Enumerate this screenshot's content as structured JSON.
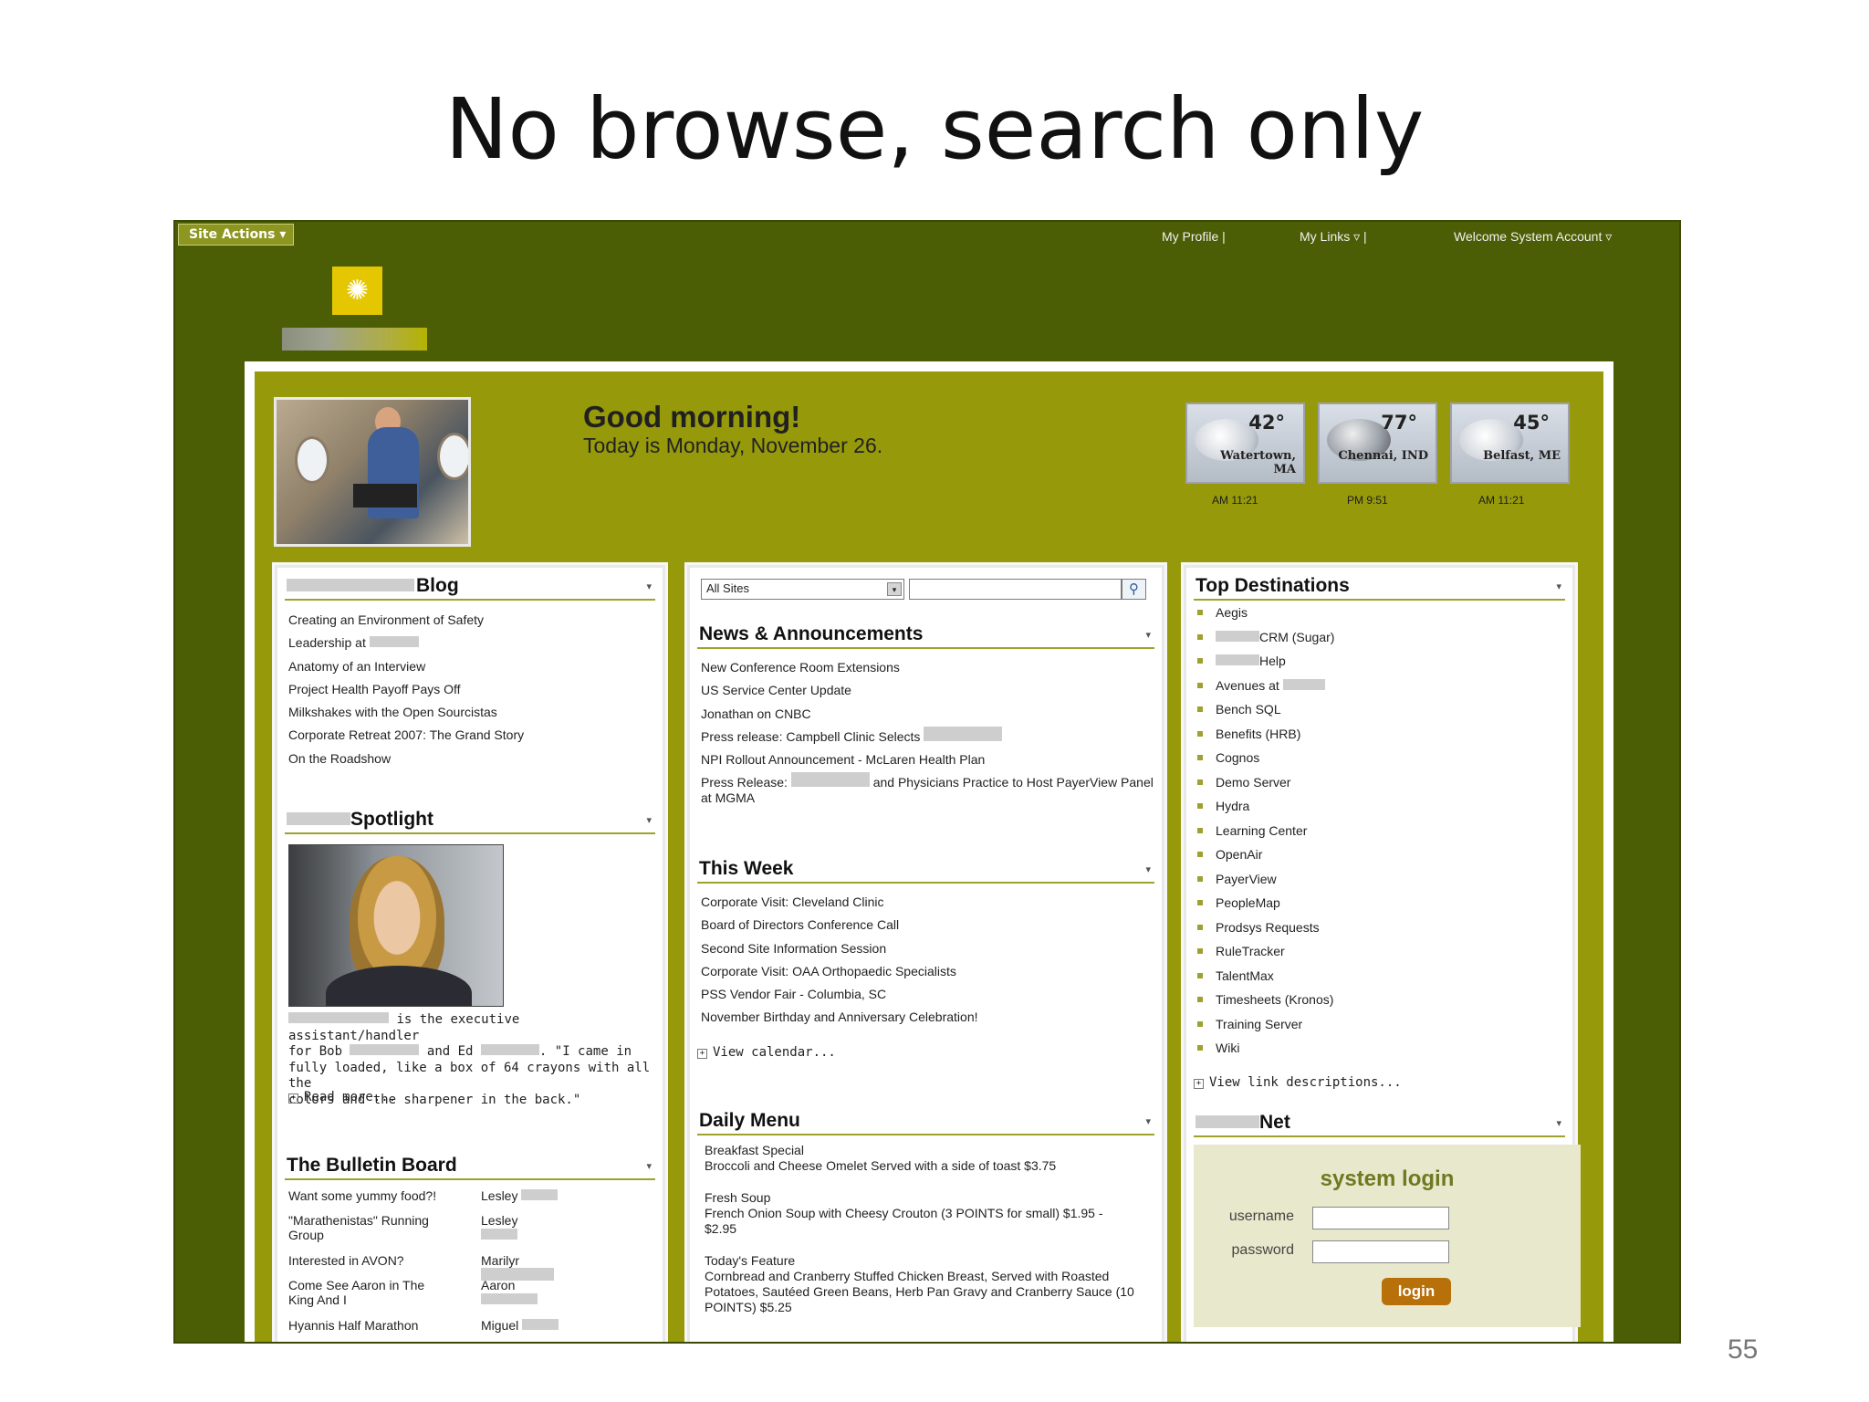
{
  "slide": {
    "title": "No browse, search only",
    "number": "55"
  },
  "topbar": {
    "site_actions": "Site Actions ▾",
    "my_profile": "My Profile |",
    "my_links": "My Links ▿ |",
    "welcome": "Welcome System Account ▿"
  },
  "colors": {
    "header_bg": "#4c5e05",
    "canvas_bg": "#96990a",
    "accent": "#b8700a"
  },
  "greeting": {
    "title": "Good morning!",
    "date": "Today is Monday, November 26."
  },
  "weather": [
    {
      "temp": "42°",
      "city": "Watertown, MA",
      "time": "AM  11:21"
    },
    {
      "temp": "77°",
      "city": "Chennai, IND",
      "time": "PM  9:51"
    },
    {
      "temp": "45°",
      "city": "Belfast, ME",
      "time": "AM  11:21"
    }
  ],
  "blog": {
    "title": "Blog",
    "items": [
      "Creating an Environment of Safety",
      "Leadership at",
      "Anatomy of an Interview",
      "Project Health Payoff Pays Off",
      "Milkshakes with the Open Sourcistas",
      "Corporate Retreat 2007: The Grand Story",
      "On the Roadshow"
    ]
  },
  "spotlight": {
    "title": "Spotlight",
    "caption_1": "is the executive assistant/handler",
    "caption_2": "for Bob",
    "caption_2b": "and Ed",
    "caption_2c": ". \"I came in",
    "caption_3": "fully loaded, like a box of 64 crayons with all the",
    "caption_4": "colors and the sharpener in the back.\"",
    "read_more": "Read more..."
  },
  "bulletin": {
    "title": "The Bulletin Board",
    "rows": [
      {
        "text": "Want some yummy food?!",
        "who": "Lesley"
      },
      {
        "text": "\"Marathenistas\" Running Group",
        "who": "Lesley"
      },
      {
        "text": "Interested in AVON?",
        "who": "Marilyr"
      },
      {
        "text": "Come See Aaron in The King And I",
        "who": "Aaron"
      },
      {
        "text": "Hyannis Half Marathon",
        "who": "Miguel"
      }
    ]
  },
  "search": {
    "scope": "All Sites",
    "placeholder": ""
  },
  "news": {
    "title": "News & Announcements",
    "items": [
      "New Conference Room Extensions",
      "US Service Center Update",
      "Jonathan on CNBC",
      "Press release: Campbell Clinic Selects",
      "NPI Rollout Announcement - McLaren Health Plan"
    ],
    "last_a": "Press Release:",
    "last_b": "and Physicians Practice to Host PayerView Panel",
    "last_c": "at MGMA"
  },
  "this_week": {
    "title": "This Week",
    "items": [
      "Corporate Visit: Cleveland Clinic",
      "Board of Directors Conference Call",
      "Second Site Information Session",
      "Corporate Visit: OAA Orthopaedic Specialists",
      "PSS Vendor Fair - Columbia, SC",
      "November Birthday and Anniversary Celebration!"
    ],
    "view_calendar": "View calendar..."
  },
  "daily_menu": {
    "title": "Daily Menu",
    "breakfast_label": "Breakfast Special",
    "breakfast": "Broccoli and Cheese Omelet Served with a side of toast $3.75",
    "soup_label": "Fresh Soup",
    "soup_1": "French Onion Soup with Cheesy Crouton (3 POINTS for small)  $1.95 -",
    "soup_2": "$2.95",
    "feature_label": "Today's Feature",
    "feature_1": "Cornbread and Cranberry Stuffed Chicken Breast, Served with Roasted",
    "feature_2": "Potatoes, Sautéed Green Beans, Herb Pan Gravy and Cranberry Sauce (10",
    "feature_3": "POINTS)  $5.25"
  },
  "destinations": {
    "title": "Top Destinations",
    "items": [
      "Aegis",
      "CRM (Sugar)",
      "Help",
      "Avenues at",
      "Bench SQL",
      "Benefits (HRB)",
      "Cognos",
      "Demo Server",
      "Hydra",
      "Learning Center",
      "OpenAir",
      "PayerView",
      "PeopleMap",
      "Prodsys Requests",
      "RuleTracker",
      "TalentMax",
      "Timesheets (Kronos)",
      "Training Server",
      "Wiki"
    ],
    "view_desc": "View link descriptions..."
  },
  "net": {
    "title": "Net",
    "login_title": "system login",
    "username_label": "username",
    "password_label": "password",
    "login_button": "login"
  }
}
